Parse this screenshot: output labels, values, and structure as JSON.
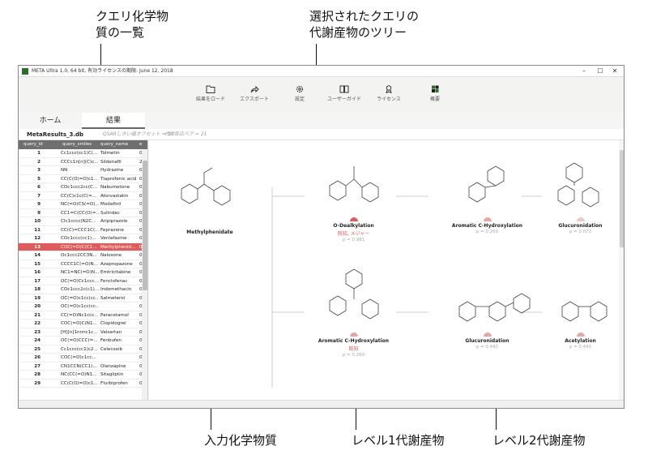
{
  "callouts": {
    "query_list": [
      "クエリ化学物",
      "質の一覧"
    ],
    "tree": [
      "選択されたクエリの",
      "代謝産物のツリー"
    ],
    "input": "入力化学物質",
    "level1": "レベル1代謝産物",
    "level2": "レベル2代謝産物"
  },
  "window": {
    "title": "META Ultra 1.0, 64 bit, 有効ライセンスの期限: June 12, 2018",
    "min": "–",
    "max": "☐",
    "close": "✕"
  },
  "toolbar": [
    {
      "label": "結果をロード",
      "icon": "folder-icon"
    },
    {
      "label": "エクスポート",
      "icon": "share-icon"
    },
    {
      "label": "設定",
      "icon": "gear-icon"
    },
    {
      "label": "ユーザーガイド",
      "icon": "book-icon"
    },
    {
      "label": "ライセンス",
      "icon": "award-icon"
    },
    {
      "label": "概要",
      "icon": "logo-icon"
    }
  ],
  "tabs": [
    "ホーム",
    "結果"
  ],
  "filebar": {
    "file": "MetaResults_3.db",
    "qsar": "QSARしきい値オフセット = 0",
    "pairs": "代謝反応ペア = 21"
  },
  "grid": {
    "columns": [
      "query_id",
      "query_smiles",
      "query_name",
      "e"
    ],
    "rows": [
      [
        "1",
        "Cc1ccc(cc1)C(...",
        "Tolmetin",
        "0"
      ],
      [
        "2",
        "CCCc1n[n](C)c...",
        "Sildenafil",
        "21"
      ],
      [
        "3",
        "NN",
        "Hydrazine",
        "0"
      ],
      [
        "5",
        "CC(C(O)=O)c1...",
        "Tiaprofenic acid",
        "0"
      ],
      [
        "6",
        "COc1ccc2cc(C...",
        "Nabumetone",
        "0"
      ],
      [
        "7",
        "CC(C)c1c(C(=...",
        "Atorvastatin",
        "0"
      ],
      [
        "9",
        "NC(=O)CS(=O)...",
        "Modafinil",
        "0"
      ],
      [
        "9",
        "CC1=C(CC(O)=...",
        "Sulindac",
        "0"
      ],
      [
        "10",
        "Clc1cccc(N2C...",
        "Aripiprazole",
        "0"
      ],
      [
        "11",
        "CC(C)=CCC1C(...",
        "Feprazone",
        "0"
      ],
      [
        "12",
        "COc1ccc(cc1)...",
        "Venlafaxine",
        "0"
      ],
      [
        "13",
        "COC(=O)C(C1...",
        "Methylphenid...",
        "0"
      ],
      [
        "14",
        "Oc1ccc2CC3N...",
        "Naloxone",
        "0"
      ],
      [
        "15",
        "CCCC1C(=O)N...",
        "Azapropazone",
        "0"
      ],
      [
        "16",
        "NC1=NC(=O)N...",
        "Emtricitabine",
        "0"
      ],
      [
        "17",
        "OC(=O)Cc1ccc...",
        "Fenclofenac",
        "0"
      ],
      [
        "18",
        "COc1ccc2c(c1)...",
        "Indomethacin",
        "0"
      ],
      [
        "19",
        "OC(=O)c1cc(cc...",
        "Salmeterol",
        "0"
      ],
      [
        "20",
        "OC(=O)c1cc(cc...",
        "",
        "0"
      ],
      [
        "21",
        "CC(=O)Nc1ccc...",
        "Paracetamol",
        "0"
      ],
      [
        "22",
        "COC(=O)C(N1...",
        "Clopidogrel",
        "0"
      ],
      [
        "23",
        "[H][n]1nnnc1c...",
        "Valsartan",
        "0"
      ],
      [
        "24",
        "OC(=O)CCC(=...",
        "Fenbufen",
        "0"
      ],
      [
        "25",
        "Cc1ccc(cc1)c2...",
        "Celecoxib",
        "0"
      ],
      [
        "26",
        "COC(=O)c1cc...",
        "",
        "0"
      ],
      [
        "27",
        "CN1CCN(CC1)...",
        "Olanzapine",
        "0"
      ],
      [
        "28",
        "NC(CC(=O)N1...",
        "Sitagliptin",
        "0"
      ],
      [
        "29",
        "CC(C(O)=O)c1...",
        "Flurbiprofen",
        "0"
      ]
    ],
    "selected_index": 11
  },
  "tree": {
    "root": {
      "label": "Methylphenidate"
    },
    "level1": [
      {
        "label": "O-Dealkylation",
        "tag": "既知, メジャー",
        "prob": "p = 0.981"
      },
      {
        "label": "Aromatic C-Hydroxylation",
        "tag": "既知",
        "prob": "p = 0.269"
      }
    ],
    "level2": [
      {
        "label": "Aromatic C-Hydroxylation",
        "prob": "p = 0.269"
      },
      {
        "label": "Glucuronidation",
        "prob": "p = 0.072"
      },
      {
        "label": "Glucuronidation",
        "prob": "p = 0.442"
      },
      {
        "label": "Acetylation",
        "prob": "p = 0.441"
      }
    ],
    "colors": {
      "known": "#e05b5b",
      "weak": "#e8a5a5",
      "grid_selected": "#e05b5b"
    }
  }
}
